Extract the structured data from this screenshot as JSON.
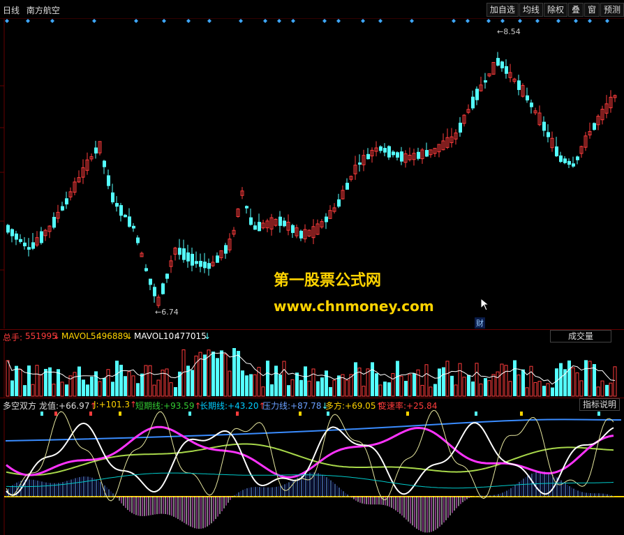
{
  "top_bar": {
    "period": "日线",
    "stock_name": "南方航空",
    "buttons": [
      "加自选",
      "均线",
      "除权",
      "叠",
      "窗",
      "预测"
    ]
  },
  "price_panel": {
    "high_label": "8.54",
    "low_label": "6.74",
    "watermark_line1": "第一股票公式网",
    "watermark_line2": "www.chnmoney.com",
    "cai_badge": "财"
  },
  "volume_panel": {
    "total_label": "总手:",
    "total_value": "551995",
    "mavol5_label": "MAVOL5:",
    "mavol5_value": "496889",
    "mavol10_label": "MAVOL10:",
    "mavol10_value": "477015",
    "dropdown": "成交量"
  },
  "indicator_panel": {
    "name": "多空双方",
    "items": [
      {
        "label": "龙值:",
        "value": "+66.97",
        "arrow": "↑"
      },
      {
        "label": "J:",
        "value": "+101.3",
        "arrow": "↑"
      },
      {
        "label": "短期线:",
        "value": "+93.59",
        "arrow": "↑"
      },
      {
        "label": "长期线:",
        "value": "+43.20",
        "arrow": "↑"
      },
      {
        "label": "压力线:",
        "value": "+87.78",
        "arrow": "↓"
      },
      {
        "label": "多方:",
        "value": "+69.05",
        "arrow": "↑"
      },
      {
        "label": "变速率:",
        "value": "+25.84",
        "arrow": ""
      }
    ],
    "button": "指标说明"
  },
  "colors": {
    "up": "#ff3c3c",
    "down": "#54ffff",
    "volume_label": "#ffd400",
    "mavol10": "#ffffff",
    "short_line": "#33cc33",
    "long_line": "#00ccff",
    "pressure_line": "#6aa0ff",
    "bull": "#ffd400",
    "rate": "#ff3c3c"
  }
}
